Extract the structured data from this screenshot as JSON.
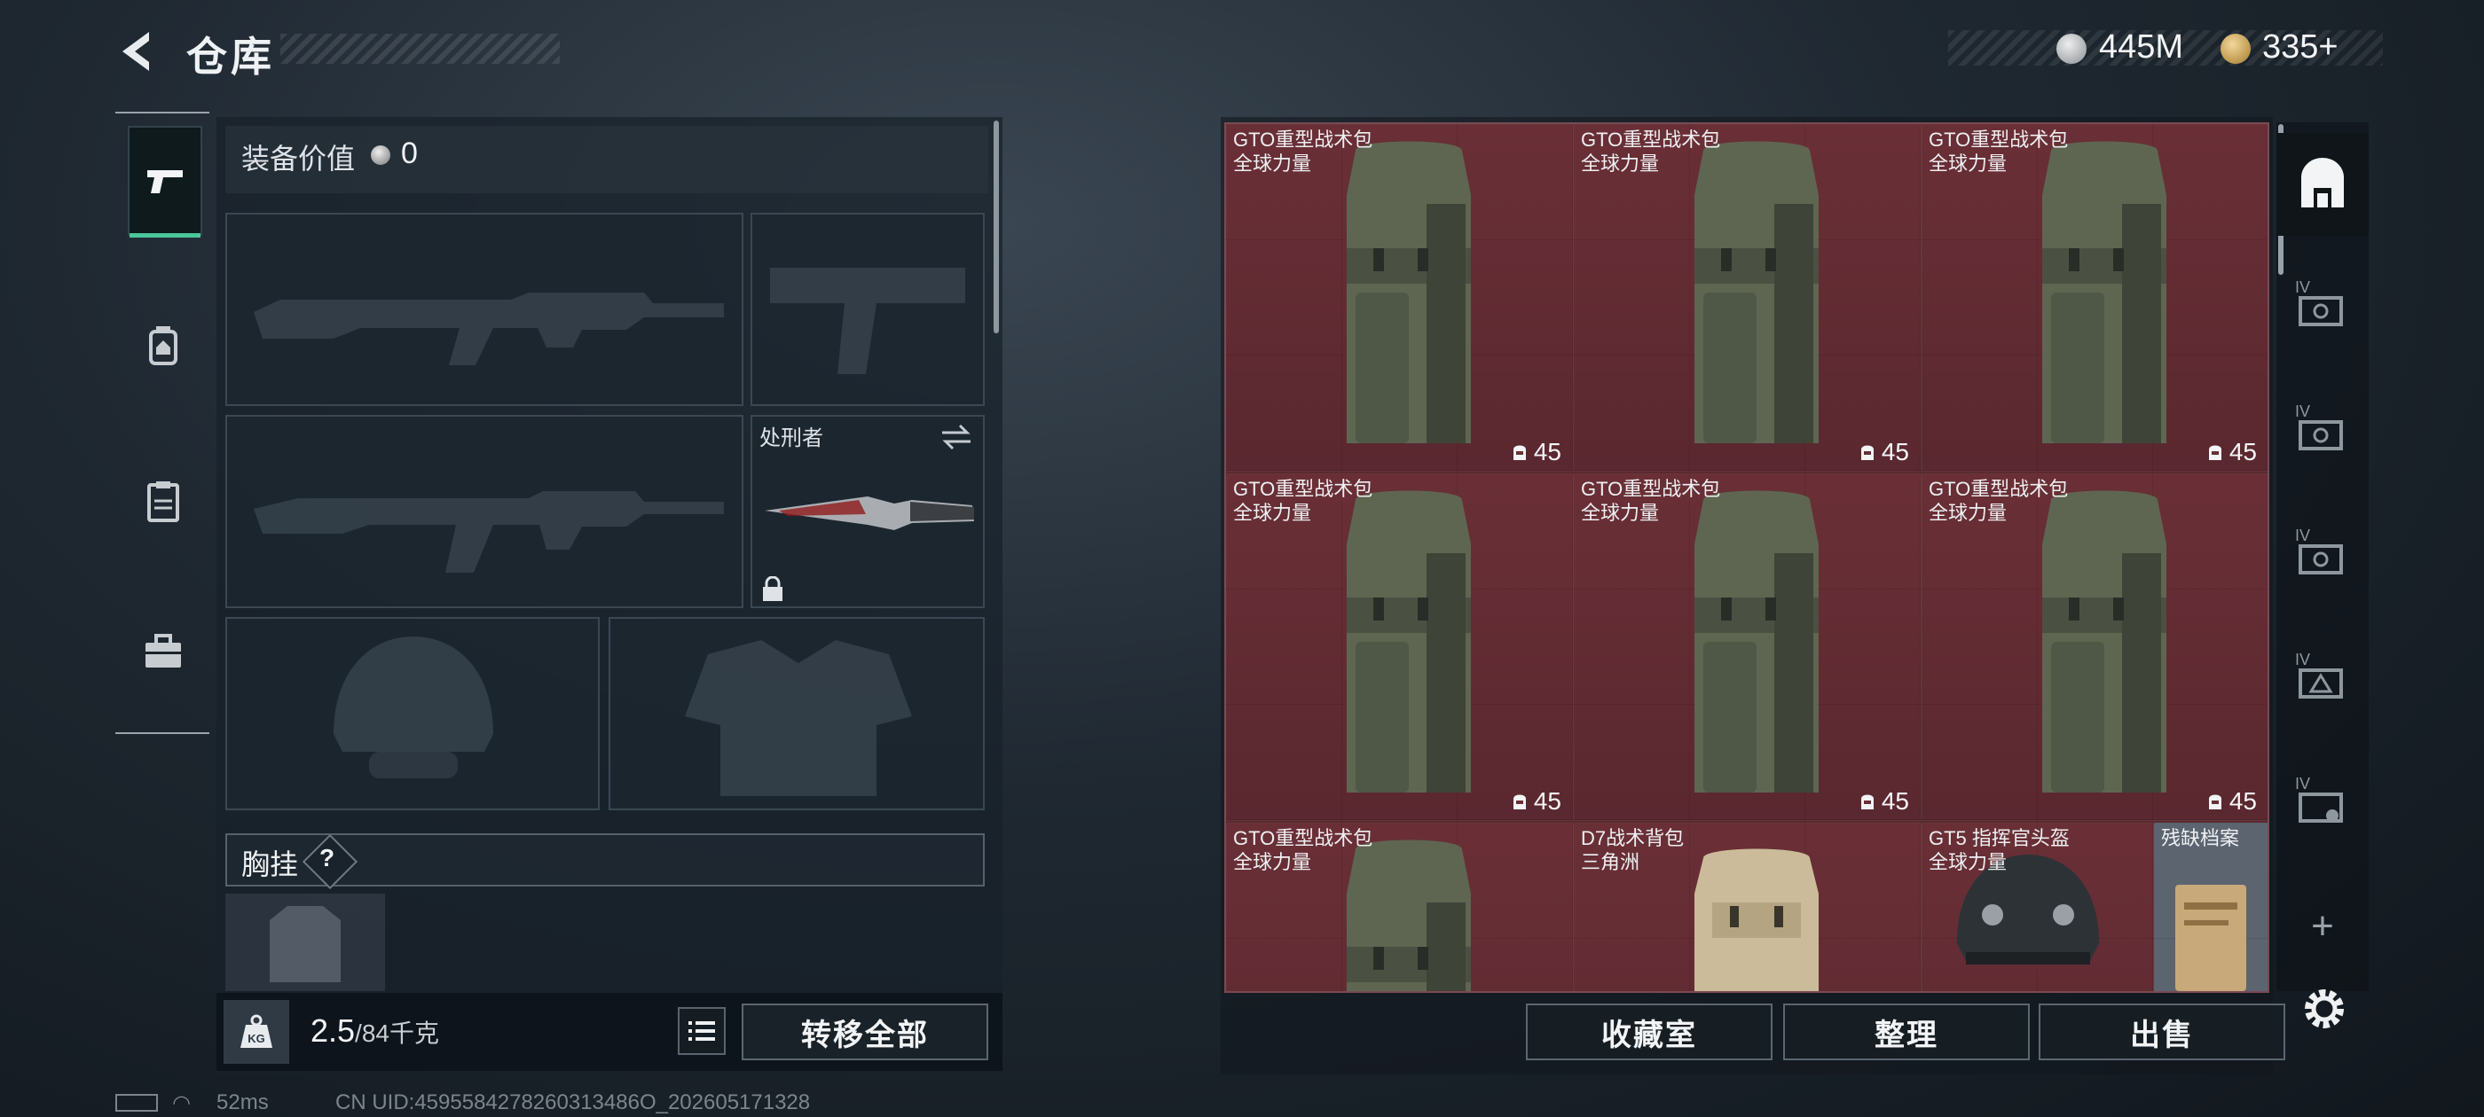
{
  "header": {
    "title": "仓库",
    "currency_silver": "445M",
    "currency_gold": "335+"
  },
  "equipment": {
    "value_label": "装备价值",
    "value": "0",
    "melee_name": "处刑者",
    "chest_rig_label": "胸挂",
    "chest_rig_help": "?",
    "weight_current": "2.5",
    "weight_max": "/84千克",
    "weight_icon_text": "KG",
    "transfer_all_label": "转移全部"
  },
  "storage": {
    "items": [
      {
        "name": "GTO重型战术包",
        "sub": "全球力量",
        "count": "45",
        "kind": "backpack-green"
      },
      {
        "name": "GTO重型战术包",
        "sub": "全球力量",
        "count": "45",
        "kind": "backpack-green"
      },
      {
        "name": "GTO重型战术包",
        "sub": "全球力量",
        "count": "45",
        "kind": "backpack-green"
      },
      {
        "name": "GTO重型战术包",
        "sub": "全球力量",
        "count": "45",
        "kind": "backpack-green"
      },
      {
        "name": "GTO重型战术包",
        "sub": "全球力量",
        "count": "45",
        "kind": "backpack-green"
      },
      {
        "name": "GTO重型战术包",
        "sub": "全球力量",
        "count": "45",
        "kind": "backpack-green"
      },
      {
        "name": "GTO重型战术包",
        "sub": "全球力量",
        "count": "",
        "kind": "backpack-green"
      },
      {
        "name": "D7战术背包",
        "sub": "三角洲",
        "count": "",
        "kind": "backpack-tan"
      },
      {
        "name": "GT5 指挥官头盔",
        "sub": "全球力量",
        "count": "",
        "kind": "helmet"
      },
      {
        "name": "残缺档案",
        "sub": "",
        "count": "",
        "kind": "document"
      }
    ],
    "buttons": {
      "collection": "收藏室",
      "sort": "整理",
      "sell": "出售"
    },
    "tab_level_label": "IV",
    "add_label": "+"
  },
  "status_bar": {
    "ping": "52ms",
    "uid": "CN UID:4595584278260313486O_202605171328"
  },
  "colors": {
    "accent": "#49c79a",
    "grid_red": "#6a2f36",
    "panel": "#18212a"
  }
}
